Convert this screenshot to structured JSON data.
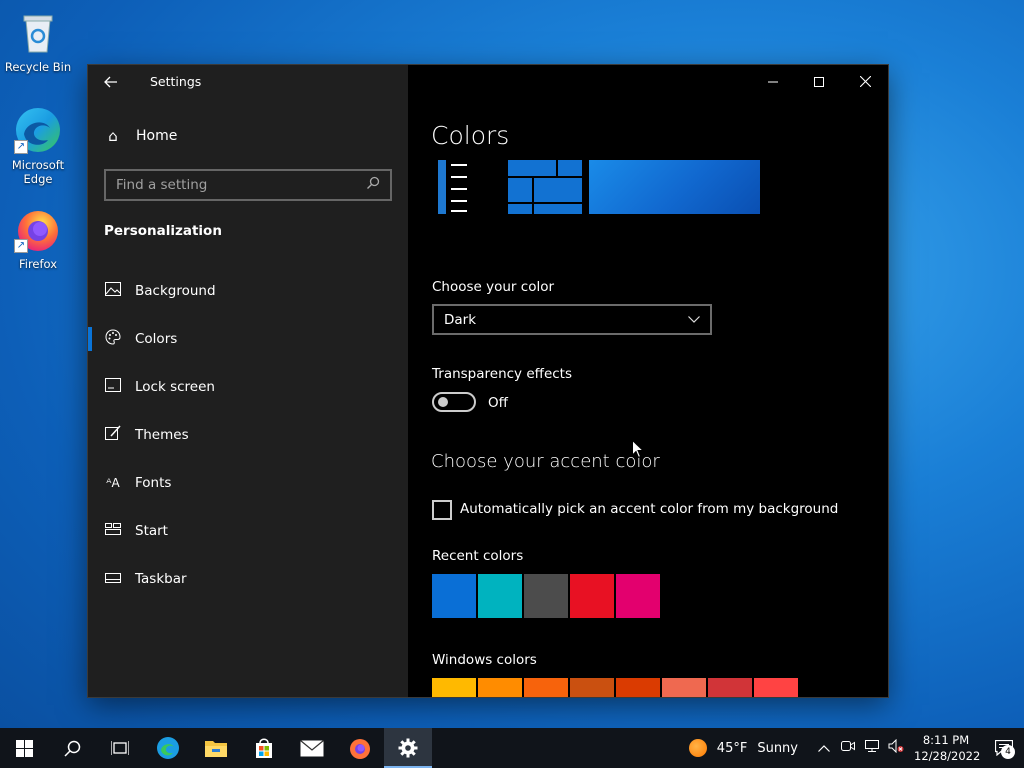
{
  "desktop": {
    "icons": [
      {
        "label": "Recycle Bin",
        "icon": "recycle-bin-icon"
      },
      {
        "label": "Microsoft Edge",
        "icon": "edge-icon"
      },
      {
        "label": "Firefox",
        "icon": "firefox-icon"
      }
    ]
  },
  "window": {
    "title": "Settings",
    "controls": {
      "minimize": "—",
      "maximize": "☐",
      "close": "✕"
    }
  },
  "sidebar": {
    "home_label": "Home",
    "search_placeholder": "Find a setting",
    "section_heading": "Personalization",
    "items": [
      {
        "label": "Background",
        "icon": "picture-icon"
      },
      {
        "label": "Colors",
        "icon": "palette-icon",
        "active": true
      },
      {
        "label": "Lock screen",
        "icon": "lock-screen-icon"
      },
      {
        "label": "Themes",
        "icon": "themes-icon"
      },
      {
        "label": "Fonts",
        "icon": "fonts-icon"
      },
      {
        "label": "Start",
        "icon": "start-icon"
      },
      {
        "label": "Taskbar",
        "icon": "taskbar-icon"
      }
    ]
  },
  "content": {
    "title": "Colors",
    "choose_color_label": "Choose your color",
    "choose_color_value": "Dark",
    "transparency_label": "Transparency effects",
    "transparency_state": "Off",
    "accent_heading": "Choose your accent color",
    "auto_pick_label": "Automatically pick an accent color from my background",
    "recent_colors_label": "Recent colors",
    "recent_colors": [
      "#0a6fd6",
      "#00b3bf",
      "#4c4c4c",
      "#e81123",
      "#e3006e"
    ],
    "windows_colors_label": "Windows colors",
    "windows_colors": [
      "#ffb900",
      "#ff8c00",
      "#f7630c",
      "#ca5010",
      "#da3b01",
      "#ef6950",
      "#d13438",
      "#ff4343"
    ]
  },
  "taskbar": {
    "weather_temp": "45°F",
    "weather_condition": "Sunny",
    "time": "8:11 PM",
    "date": "12/28/2022",
    "notification_count": "4",
    "accent_color": "#0a74d8"
  }
}
